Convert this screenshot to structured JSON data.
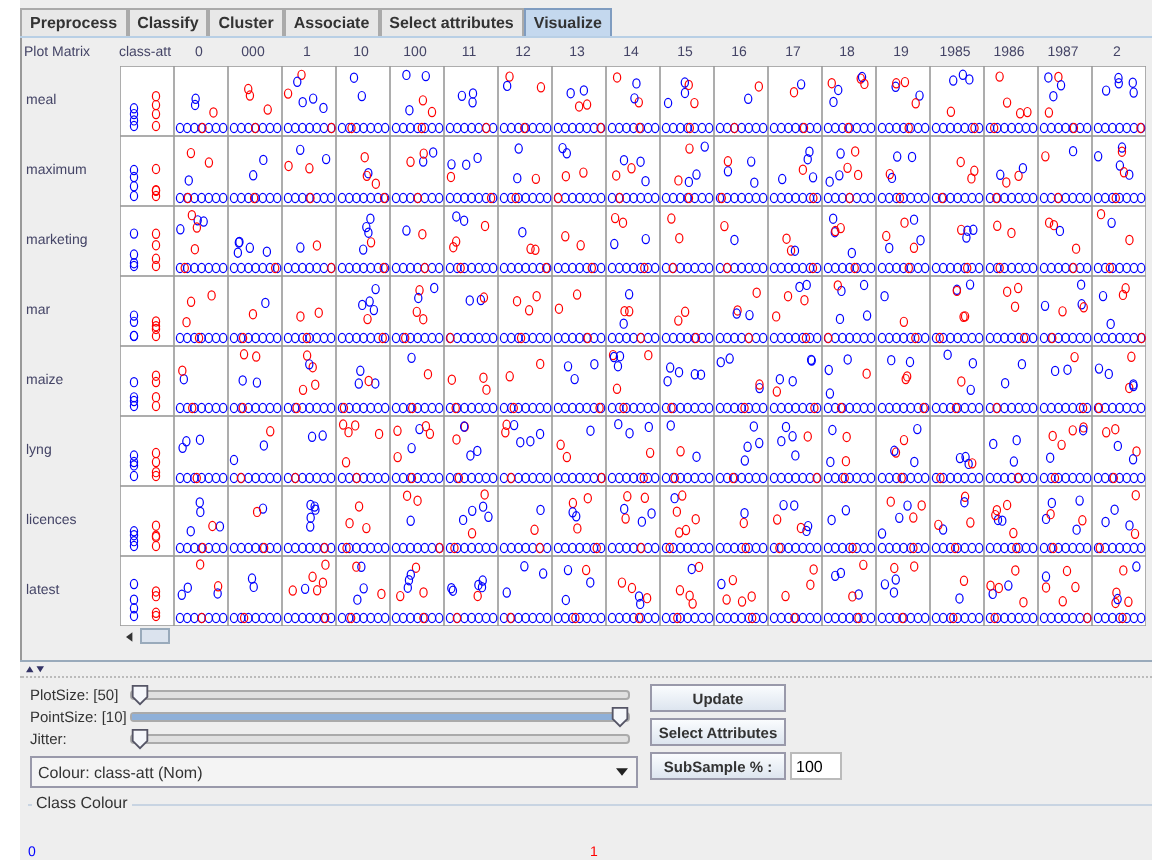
{
  "tabs": [
    {
      "label": "Preprocess",
      "selected": false
    },
    {
      "label": "Classify",
      "selected": false
    },
    {
      "label": "Cluster",
      "selected": false
    },
    {
      "label": "Associate",
      "selected": false
    },
    {
      "label": "Select attributes",
      "selected": false
    },
    {
      "label": "Visualize",
      "selected": true
    }
  ],
  "matrix": {
    "title": "Plot Matrix",
    "columns": [
      "class-att",
      "0",
      "000",
      "1",
      "10",
      "100",
      "11",
      "12",
      "13",
      "14",
      "15",
      "16",
      "17",
      "18",
      "19",
      "1985",
      "1986",
      "1987",
      "2"
    ],
    "rows": [
      "meal",
      "maximum",
      "marketing",
      "mar",
      "maize",
      "lyng",
      "licences",
      "latest"
    ]
  },
  "sliders": [
    {
      "label": "PlotSize: [50]",
      "level": 0
    },
    {
      "label": "PointSize: [10]",
      "level": 1
    },
    {
      "label": "Jitter:",
      "level": 0
    }
  ],
  "colour_dropdown": {
    "value": "Colour: class-att (Nom)"
  },
  "buttons": [
    "Update",
    "Select Attributes"
  ],
  "subsample": {
    "label": "SubSample % :",
    "value": "100"
  },
  "class_colour": {
    "title": "Class Colour",
    "classes": [
      {
        "label": "0",
        "color": "#0000ff"
      },
      {
        "label": "1",
        "color": "#ff0000"
      }
    ]
  }
}
